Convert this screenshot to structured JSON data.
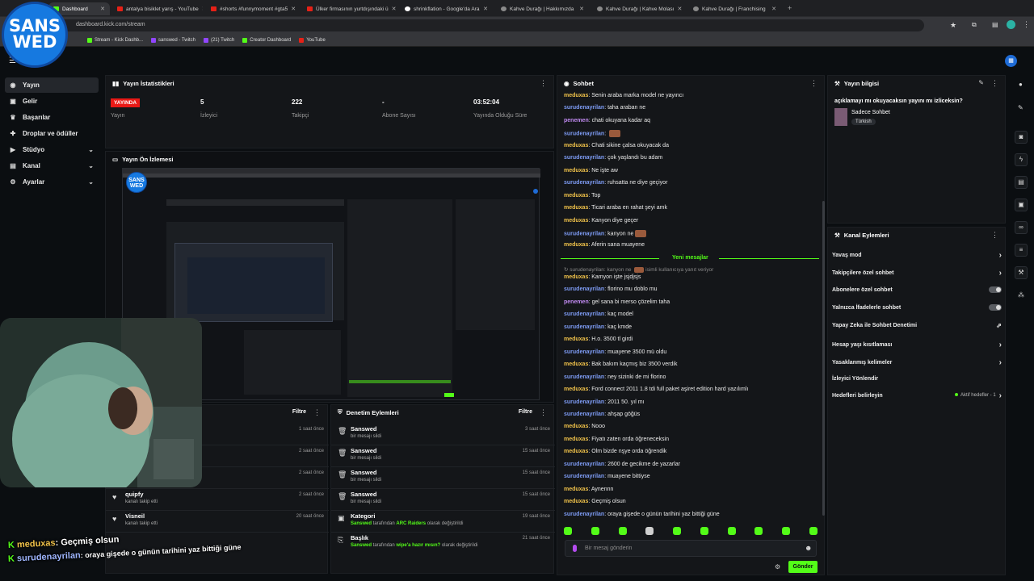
{
  "browser": {
    "tabs": [
      {
        "label": "Dashboard",
        "icon": "kick-icon",
        "active": true
      },
      {
        "label": "antalya bisiklet yarış - YouTube",
        "icon": "youtube-icon"
      },
      {
        "label": "#shorts #funnymoment #gta5",
        "icon": "youtube-icon"
      },
      {
        "label": "Ülker firmasının yurtdışındaki ü",
        "icon": "youtube-icon"
      },
      {
        "label": "shrinkflation - Google'da Ara",
        "icon": "google-icon"
      },
      {
        "label": "Kahve Durağı | Hakkımızda",
        "icon": "site-icon"
      },
      {
        "label": "Kahve Durağı | Kahve Molası",
        "icon": "site-icon"
      },
      {
        "label": "Kahve Durağı | Franchising",
        "icon": "site-icon"
      }
    ],
    "url": "dashboard.kick.com/stream",
    "bookmarks": [
      "Stream - Kick Dashb...",
      "sanswed - Twitch",
      "(21) Twitch",
      "Creator Dashboard",
      "YouTube"
    ]
  },
  "logo": {
    "line1": "SANS",
    "line2": "WED"
  },
  "sidebar": {
    "items": [
      {
        "label": "Yayın",
        "icon": "broadcast-icon",
        "active": true
      },
      {
        "label": "Gelir",
        "icon": "wallet-icon"
      },
      {
        "label": "Başarılar",
        "icon": "trophy-icon"
      },
      {
        "label": "Droplar ve ödüller",
        "icon": "gift-icon"
      },
      {
        "label": "Stüdyo",
        "icon": "studio-icon",
        "chevron": true
      },
      {
        "label": "Kanal",
        "icon": "channel-icon",
        "chevron": true
      },
      {
        "label": "Ayarlar",
        "icon": "gear-icon",
        "chevron": true
      }
    ]
  },
  "stats": {
    "title": "Yayın İstatistikleri",
    "items": [
      {
        "value": "YAYINDA",
        "label": "Yayın"
      },
      {
        "value": "5",
        "label": "İzleyici"
      },
      {
        "value": "222",
        "label": "Takipçi"
      },
      {
        "value": "-",
        "label": "Abone Sayısı"
      },
      {
        "value": "03:52:04",
        "label": "Yayında Olduğu Süre"
      }
    ]
  },
  "preview": {
    "title": "Yayın Ön İzlemesi"
  },
  "activity": {
    "filter_label": "Filtre",
    "rows": [
      {
        "name": "",
        "sub": "",
        "time": "1 saat önce"
      },
      {
        "name": "",
        "sub": "",
        "time": "2 saat önce"
      },
      {
        "name": "",
        "sub": "",
        "time": "2 saat önce"
      },
      {
        "name": "quipfy",
        "sub": "kanalı takip etti",
        "time": "2 saat önce"
      },
      {
        "name": "Visneil",
        "sub": "kanalı takip etti",
        "time": "20 saat önce"
      }
    ]
  },
  "moderation": {
    "title": "Denetim Eylemleri",
    "filter_label": "Filtre",
    "rows": [
      {
        "name": "Sanswed",
        "sub": "bir mesajı sildi",
        "time": "3 saat önce"
      },
      {
        "name": "Sanswed",
        "sub": "bir mesajı sildi",
        "time": "15 saat önce"
      },
      {
        "name": "Sanswed",
        "sub": "bir mesajı sildi",
        "time": "15 saat önce"
      },
      {
        "name": "Sanswed",
        "sub": "bir mesajı sildi",
        "time": "15 saat önce"
      },
      {
        "name": "Kategori",
        "sub_user": "Sanswed",
        "sub_mid": " tarafından ",
        "sub_val": "ARC Raiders",
        "sub_end": " olarak değiştirildi",
        "time": "19 saat önce"
      },
      {
        "name": "Başlık",
        "sub_user": "Sanswed",
        "sub_mid": " tarafından ",
        "sub_val": "wipe'a hazır mısın?",
        "sub_end": " olarak değiştirildi",
        "time": "21 saat önce"
      }
    ]
  },
  "chat": {
    "title": "Sohbet",
    "messages_top": [
      {
        "user": "meduxas",
        "text": "Senin araba marka model ne yayıncı"
      },
      {
        "user": "surudenayrilan",
        "text": "taha araban ne"
      },
      {
        "user": "penemen",
        "text": "chati okuyana kadar aq"
      },
      {
        "user": "surudenayrilan",
        "text": "",
        "emote": true
      },
      {
        "user": "meduxas",
        "text": "Chati sikine çalsa okuyacak da"
      },
      {
        "user": "surudenayrilan",
        "text": "çok yaşlandı bu adam"
      },
      {
        "user": "meduxas",
        "text": "Ne işte aw"
      },
      {
        "user": "surudenayrilan",
        "text": "ruhsatta ne diye geçiyor"
      },
      {
        "user": "meduxas",
        "text": "Top"
      },
      {
        "user": "meduxas",
        "text": "Ticari araba en rahat şeyi amk"
      },
      {
        "user": "meduxas",
        "text": "Kanyon diye geçer"
      },
      {
        "user": "surudenayrilan",
        "text": "kanyon ne",
        "emote": true
      },
      {
        "user": "meduxas",
        "text": "Aferin sana muayene"
      }
    ],
    "new_messages": "Yeni mesajlar",
    "reply_hint": "surudenayrilan: kanyon ne",
    "reply_hint_tail": "isimli kullanıcıya yanıt veriyor",
    "messages_bottom": [
      {
        "user": "meduxas",
        "text": "Kamyon işte jsjdjsjs"
      },
      {
        "user": "surudenayrilan",
        "text": "florino mu doblo mu"
      },
      {
        "user": "penemen",
        "text": "gel sana bi merso çözelim taha"
      },
      {
        "user": "surudenayrilan",
        "text": "kaç model"
      },
      {
        "user": "surudenayrilan",
        "text": "kaç kmde"
      },
      {
        "user": "meduxas",
        "text": "H.o. 3500 tl girdi"
      },
      {
        "user": "surudenayrilan",
        "text": "muayene 3500 mü oldu"
      },
      {
        "user": "meduxas",
        "text": "Bak bakım kaçmış biz 3500 verdik"
      },
      {
        "user": "surudenayrilan",
        "text": "ney sizinki de mi florino"
      },
      {
        "user": "meduxas",
        "text": "Ford connect 2011 1.8 tdi full paket aşiret edition hard yazılımlı"
      },
      {
        "user": "surudenayrilan",
        "text": "2011 50. yıl mı"
      },
      {
        "user": "surudenayrilan",
        "text": "ahşap göğüs"
      },
      {
        "user": "meduxas",
        "text": "Nooo"
      },
      {
        "user": "meduxas",
        "text": "Fiyatı zaten orda öğreneceksin"
      },
      {
        "user": "meduxas",
        "text": "Olm bizde nşye orda öğrendik"
      },
      {
        "user": "surudenayrilan",
        "text": "2600 de gecikme de yazarlar"
      },
      {
        "user": "surudenayrilan",
        "text": "muayene bittiyse"
      },
      {
        "user": "meduxas",
        "text": "Aynennn"
      },
      {
        "user": "meduxas",
        "text": "Geçmiş olsun"
      },
      {
        "user": "surudenayrilan",
        "text": "oraya gişede o günün tarihini yaz bittiği güne"
      }
    ],
    "input_placeholder": "Bir mesaj gönderin",
    "send_label": "Gönder"
  },
  "stream_info": {
    "title": "Yayın bilgisi",
    "stream_title": "açıklamayı mı okuyacaksın yayını mı izliceksin?",
    "category": "Sadece Sohbet",
    "language": "Türkish"
  },
  "channel_actions": {
    "title": "Kanal Eylemleri",
    "items": [
      {
        "label": "Yavaş mod",
        "control": "chevron"
      },
      {
        "label": "Takipçilere özel sohbet",
        "control": "chevron"
      },
      {
        "label": "Abonelere özel sohbet",
        "control": "toggle"
      },
      {
        "label": "Yalnızca İfadelerle sohbet",
        "control": "toggle"
      },
      {
        "label": "Yapay Zeka ile Sohbet Denetimi",
        "control": "external"
      },
      {
        "label": "Hesap yaşı kısıtlaması",
        "control": "chevron"
      },
      {
        "label": "Yasaklanmış kelimeler",
        "control": "chevron"
      },
      {
        "label": "İzleyici Yönlendir",
        "control": "none"
      },
      {
        "label": "Hedefleri belirleyin",
        "control": "chevron",
        "status": "Aktif hedefler - 1"
      }
    ]
  },
  "overlay_chat": [
    {
      "user": "meduxas",
      "text": ": Geçmiş olsun"
    },
    {
      "user": "surudenayrilan",
      "text": ": oraya gişede o günün tarihini yaz bittiği güne"
    }
  ],
  "colors": {
    "accent": "#53fc18",
    "live": "#e91916",
    "panel": "#141619",
    "background": "#0b0e11"
  }
}
